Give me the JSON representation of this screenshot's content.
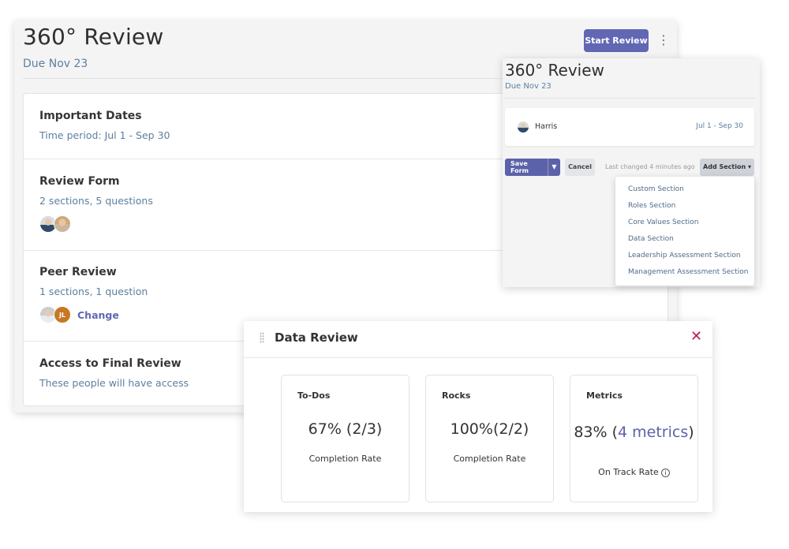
{
  "review": {
    "title": "360° Review",
    "due": "Due Nov 23",
    "start_button": "Start Review"
  },
  "sections": [
    {
      "title": "Important Dates",
      "subtitle": "Time period: Jul 1 - Sep 30"
    },
    {
      "title": "Review Form",
      "subtitle": "2 sections, 5 questions"
    },
    {
      "title": "Peer Review",
      "subtitle": "1 sections, 1 question",
      "change_label": "Change",
      "initials": "JL"
    },
    {
      "title": "Access to Final Review",
      "subtitle": "These people will have access"
    }
  ],
  "form_panel": {
    "title": "360° Review",
    "due": "Due Nov 23",
    "member": {
      "name": "Harris",
      "period": "Jul 1 - Sep 30"
    },
    "save_button": "Save Form",
    "cancel_button": "Cancel",
    "last_changed": "Last changed 4 minutes ago",
    "add_section_button": "Add Section",
    "add_section_options": [
      "Custom Section",
      "Roles Section",
      "Core Values Section",
      "Data Section",
      "Leadership Assessment Section",
      "Management Assessment Section"
    ]
  },
  "data_review": {
    "title": "Data Review",
    "cards": [
      {
        "name": "To-Dos",
        "value": "67% (2/3)",
        "caption": "Completion Rate"
      },
      {
        "name": "Rocks",
        "value": "100%(2/2)",
        "caption": "Completion Rate"
      },
      {
        "name": "Metrics",
        "value_prefix": "83% (",
        "value_link": "4 metrics",
        "value_suffix": ")",
        "caption": "On Track Rate"
      }
    ]
  },
  "colors": {
    "accent": "#6167b2",
    "subtext": "#5c7f9e",
    "close": "#c2185b",
    "background": "#f4f4f5"
  },
  "icons": {
    "kebab": "more-vertical-icon",
    "close": "close-icon",
    "drag": "drag-handle-icon",
    "info": "info-icon",
    "caret": "caret-down-icon"
  }
}
